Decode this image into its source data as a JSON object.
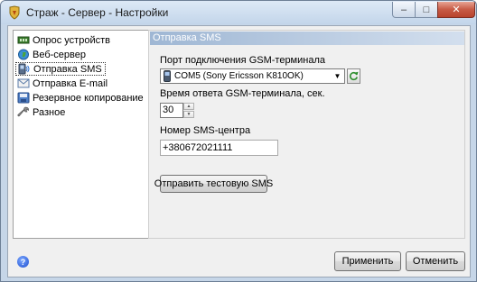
{
  "window": {
    "title": "Страж - Сервер - Настройки",
    "buttons": {
      "minimize": "–",
      "maximize": "□",
      "close": "✕"
    }
  },
  "sidebar": {
    "items": [
      {
        "label": "Опрос устройств",
        "icon": "device-poll-icon"
      },
      {
        "label": "Веб-сервер",
        "icon": "globe-icon"
      },
      {
        "label": "Отправка SMS",
        "icon": "sms-icon",
        "selected": true
      },
      {
        "label": "Отправка E-mail",
        "icon": "email-icon"
      },
      {
        "label": "Резервное копирование",
        "icon": "backup-icon"
      },
      {
        "label": "Разное",
        "icon": "wrench-icon"
      }
    ]
  },
  "panel": {
    "header": "Отправка SMS",
    "port_label": "Порт подключения GSM-терминала",
    "port_value": "COM5 (Sony Ericsson K810OK)",
    "timeout_label": "Время ответа GSM-терминала, сек.",
    "timeout_value": "30",
    "smsc_label": "Номер SMS-центра",
    "smsc_value": "+380672021111",
    "test_button": "Отправить тестовую SMS"
  },
  "footer": {
    "help": "?",
    "apply_button": "Применить",
    "cancel_button": "Отменить"
  },
  "colors": {
    "panel_header_start": "#9fb7d4",
    "window_frame": "#c6d6e8",
    "close_button": "#c75a45"
  }
}
